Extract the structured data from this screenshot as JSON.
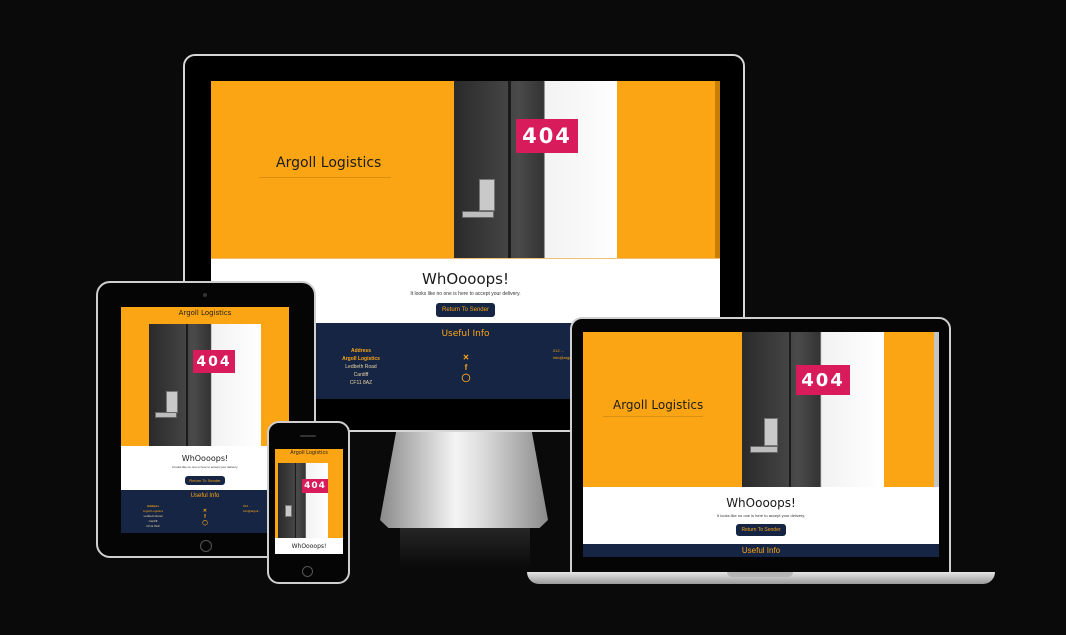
{
  "site": {
    "brand": "Argoll Logistics",
    "sign": "404",
    "heading": "WhOooops!",
    "subtext": "It looks like no one is here to accept your delivery.",
    "button": "Return To Sender",
    "footer_title": "Useful Info",
    "address_title": "Address",
    "address": [
      "Argoll Logistics",
      "Ledbeth Road",
      "Cardiff",
      "CF11 8AZ"
    ],
    "phone": "012 ...",
    "email": "info@argoll...",
    "social_icons": [
      "x-icon",
      "facebook-icon",
      "instagram-icon"
    ]
  },
  "colors": {
    "background": "#0b0a0a",
    "accent": "#fba514",
    "navy": "#162544",
    "sign_red": "#d81b5b"
  }
}
